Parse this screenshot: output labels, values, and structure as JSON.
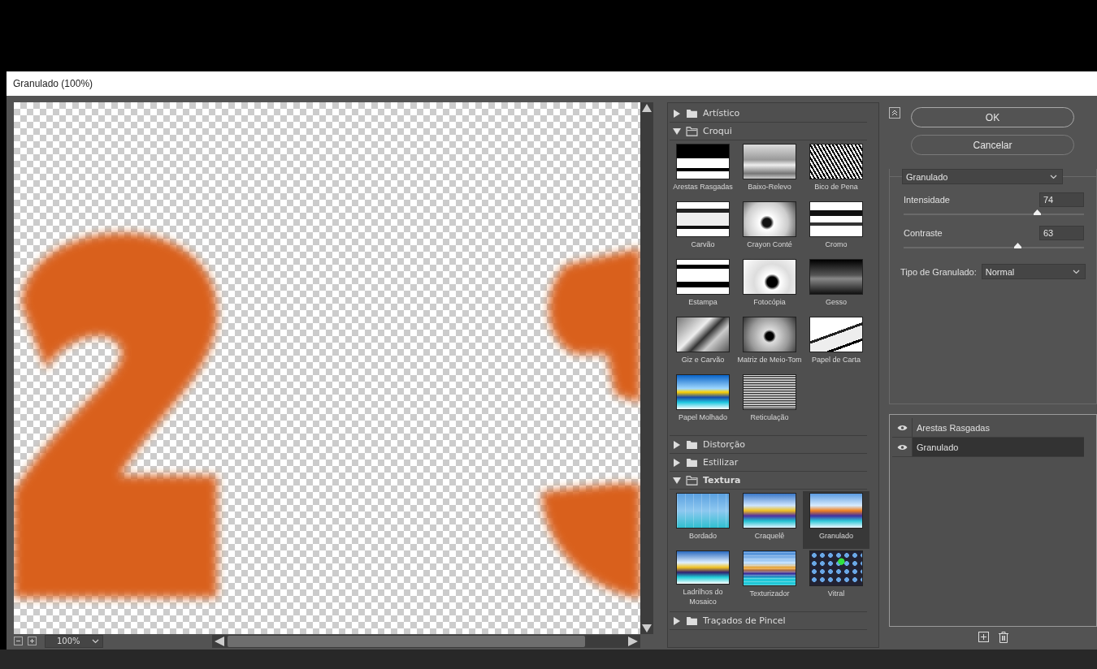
{
  "window": {
    "title": "Granulado (100%)"
  },
  "preview": {
    "zoom": "100%"
  },
  "gallery": [
    {
      "name": "Artístico",
      "expanded": false
    },
    {
      "name": "Croqui",
      "expanded": true,
      "filters": [
        {
          "name": "Arestas Rasgadas",
          "selected": false
        },
        {
          "name": "Baixo-Relevo",
          "selected": false
        },
        {
          "name": "Bico de Pena",
          "selected": false
        },
        {
          "name": "Carvão",
          "selected": false
        },
        {
          "name": "Crayon Conté",
          "selected": false
        },
        {
          "name": "Cromo",
          "selected": false
        },
        {
          "name": "Estampa",
          "selected": false
        },
        {
          "name": "Fotocópia",
          "selected": false
        },
        {
          "name": "Gesso",
          "selected": false
        },
        {
          "name": "Giz e Carvão",
          "selected": false
        },
        {
          "name": "Matriz de Meio-Tom",
          "selected": false
        },
        {
          "name": "Papel de Carta",
          "selected": false
        },
        {
          "name": "Papel Molhado",
          "selected": false
        },
        {
          "name": "Reticulação",
          "selected": false
        }
      ]
    },
    {
      "name": "Distorção",
      "expanded": false
    },
    {
      "name": "Estilizar",
      "expanded": false
    },
    {
      "name": "Textura",
      "expanded": true,
      "filters": [
        {
          "name": "Bordado",
          "selected": false
        },
        {
          "name": "Craquelê",
          "selected": false
        },
        {
          "name": "Granulado",
          "selected": true
        },
        {
          "name": "Ladrilhos do Mosaico",
          "selected": false
        },
        {
          "name": "Texturizador",
          "selected": false
        },
        {
          "name": "Vitral",
          "selected": false
        }
      ]
    },
    {
      "name": "Traçados de Pincel",
      "expanded": false
    }
  ],
  "buttons": [
    "OK",
    "Cancelar"
  ],
  "settings": {
    "filter": "Granulado",
    "sliders": [
      {
        "label": "Intensidade",
        "value": "74",
        "level": 0.74
      },
      {
        "label": "Contraste",
        "value": "63",
        "level": 0.63
      }
    ],
    "type_label": "Tipo de Granulado:",
    "type_value": "Normal"
  },
  "effect_layers": [
    {
      "name": "Arestas Rasgadas",
      "visible": true,
      "selected": false
    },
    {
      "name": "Granulado",
      "visible": true,
      "selected": true
    }
  ]
}
